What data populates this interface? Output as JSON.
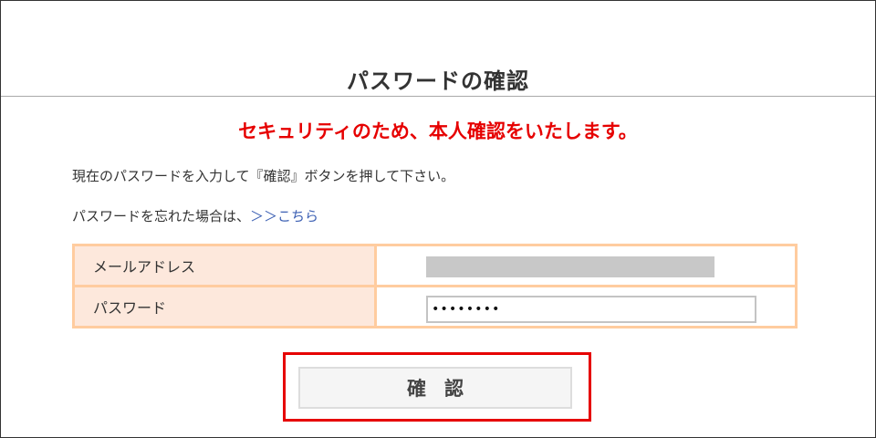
{
  "page": {
    "title": "パスワードの確認",
    "notice": "セキュリティのため、本人確認をいたします。",
    "instruction": "現在のパスワードを入力して『確認』ボタンを押して下さい。",
    "forgot_prefix": "パスワードを忘れた場合は、",
    "forgot_link": "＞＞こちら"
  },
  "form": {
    "email_label": "メールアドレス",
    "password_label": "パスワード",
    "password_value": "••••••••"
  },
  "button": {
    "confirm_label": "確認"
  },
  "colors": {
    "notice": "#e60000",
    "highlight": "#e60000",
    "label_bg": "#fde8dc",
    "table_border": "#ffcc9f",
    "link": "#3b5fb3"
  }
}
